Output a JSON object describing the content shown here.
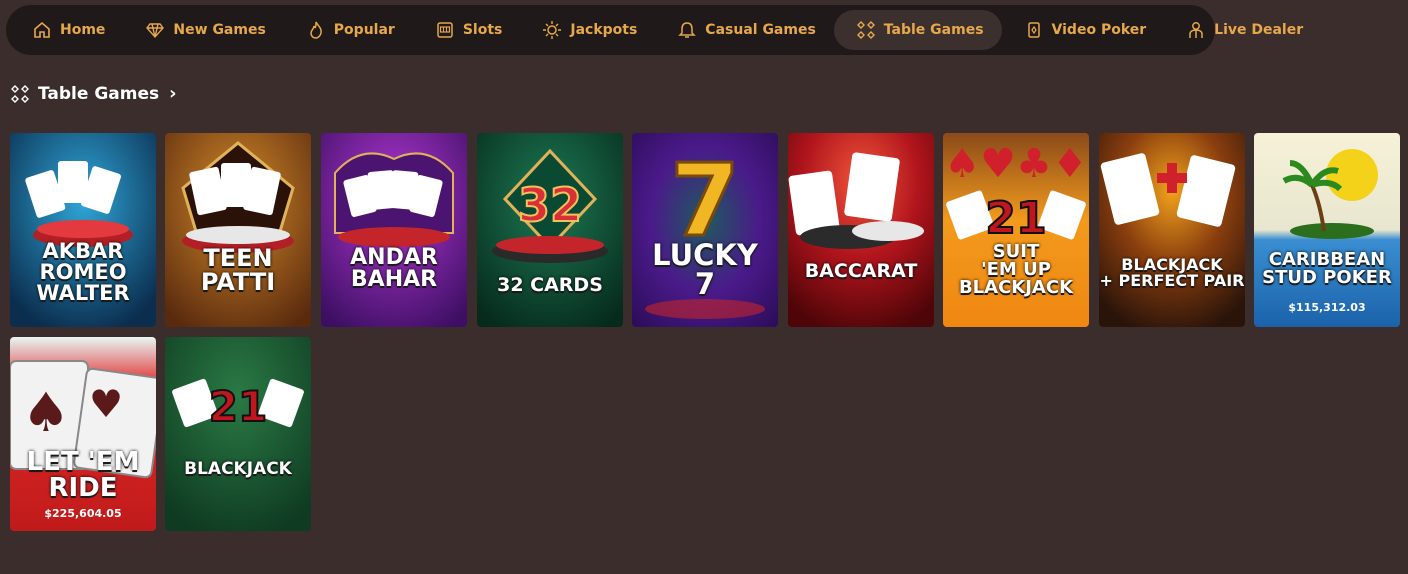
{
  "nav": {
    "items": [
      {
        "label": "Home",
        "icon": "home-icon"
      },
      {
        "label": "New Games",
        "icon": "diamond-icon"
      },
      {
        "label": "Popular",
        "icon": "flame-icon"
      },
      {
        "label": "Slots",
        "icon": "slot-machine-icon"
      },
      {
        "label": "Jackpots",
        "icon": "jackpot-icon"
      },
      {
        "label": "Casual Games",
        "icon": "bell-icon"
      },
      {
        "label": "Table Games",
        "icon": "table-games-icon",
        "active": true
      },
      {
        "label": "Video Poker",
        "icon": "card-icon"
      },
      {
        "label": "Live Dealer",
        "icon": "dealer-icon"
      }
    ],
    "accent": "#e6a84a"
  },
  "section": {
    "title": "Table Games",
    "icon": "table-games-icon",
    "chevron": "chevron-right-icon"
  },
  "games": [
    {
      "title": "AKBAR\nROMEO\nWALTER",
      "jackpot": ""
    },
    {
      "title": "TEEN\nPATTI",
      "jackpot": ""
    },
    {
      "title": "ANDAR\nBAHAR",
      "jackpot": ""
    },
    {
      "title": "32 CARDS",
      "jackpot": ""
    },
    {
      "title": "LUCKY\n7",
      "jackpot": ""
    },
    {
      "title": "BACCARAT",
      "jackpot": ""
    },
    {
      "title": "SUIT\n'EM UP\nBLACKJACK",
      "jackpot": ""
    },
    {
      "title": "BLACKJACK\n+ PERFECT PAIR",
      "jackpot": ""
    },
    {
      "title": "CARIBBEAN\nSTUD POKER",
      "jackpot": "$115,312.03"
    },
    {
      "title": "LET 'EM\nRIDE",
      "jackpot": "$225,604.05"
    },
    {
      "title": "BLACKJACK",
      "jackpot": ""
    }
  ]
}
